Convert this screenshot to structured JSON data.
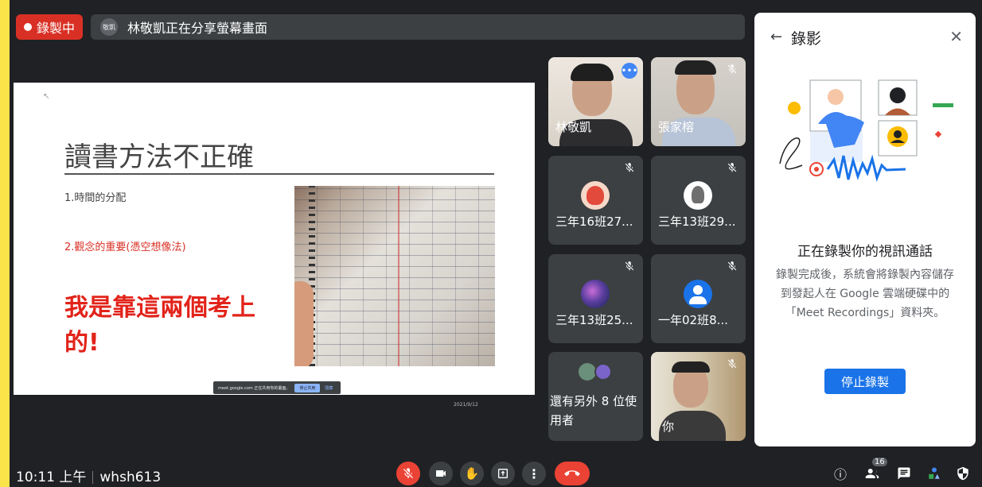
{
  "top": {
    "recording_label": "錄製中",
    "presenter_avatar": "敬凱",
    "share_text": "林敬凱正在分享螢幕畫面"
  },
  "slide": {
    "title": "讀書方法不正確",
    "point1": "1.時間的分配",
    "point2": "2.觀念的重要(憑空想像法)",
    "emphasis": "我是靠這兩個考上的!",
    "notify_text": "meet.google.com 正在共用你的畫面。",
    "notify_stop": "停止共用",
    "notify_hide": "隱藏",
    "date": "2021/9/12"
  },
  "participants": [
    {
      "name": "林敬凱"
    },
    {
      "name": "張家榕"
    },
    {
      "name": "三年16班27..."
    },
    {
      "name": "三年13班29..."
    },
    {
      "name": "三年13班25..."
    },
    {
      "name": "一年02班8..."
    },
    {
      "name": "還有另外 8 位使用者"
    },
    {
      "name": "你"
    }
  ],
  "panel": {
    "title": "錄影",
    "heading": "正在錄製你的視訊通話",
    "body": "錄製完成後，系統會將錄製內容儲存到發起人在 Google 雲端硬碟中的「Meet Recordings」資料夾。",
    "stop_button": "停止錄製"
  },
  "bottom": {
    "time": "10:11 上午",
    "meeting_code": "whsh613",
    "people_count": "16"
  },
  "colors": {
    "stage": "#202124",
    "recording_red": "#d93025",
    "accent_blue": "#1a73e8",
    "tile": "#3c4043"
  }
}
